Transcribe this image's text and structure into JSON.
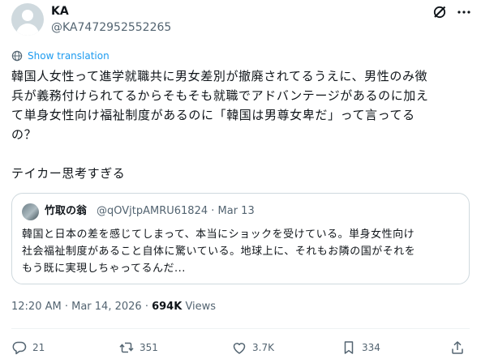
{
  "author": {
    "display_name": "KA",
    "handle": "@KA7472952552265"
  },
  "translate_label": "Show translation",
  "tweet": {
    "text": "韓国人女性って進学就職共に男女差別が撤廃されてるうえに、男性のみ徴\n兵が義務付けられてるからそもそも就職でアドバンテージがあるのに加え\nて単身女性向け福祉制度があるのに「韓国は男尊女卑だ」って言ってる\nの？\n\nテイカー思考すぎる"
  },
  "quote": {
    "author_name": "竹取の翁",
    "handle_date": "@qOVjtpAMRU61824 · Mar 13",
    "text": "韓国と日本の差を感じてしまって、本当にショックを受けている。単身女性向け\n社会福祉制度があること自体に驚いている。地球上に、それもお隣の国がそれを\nもう既に実現しちゃってるんだ..."
  },
  "meta": {
    "time": "12:20 AM",
    "date": "Mar 14, 2026",
    "views_count": "694K",
    "views_label": "Views"
  },
  "actions": {
    "replies": "21",
    "reposts": "351",
    "likes": "3.7K",
    "bookmarks": "334"
  },
  "icons": {
    "header": [
      "grok-icon",
      "more-icon"
    ],
    "translate": "globe-icon",
    "actions": [
      "reply-icon",
      "repost-icon",
      "like-icon",
      "bookmark-icon",
      "share-icon"
    ]
  },
  "colors": {
    "text": "#0f1419",
    "secondary": "#536471",
    "link": "#1d9bf0",
    "border": "#cfd9de"
  }
}
